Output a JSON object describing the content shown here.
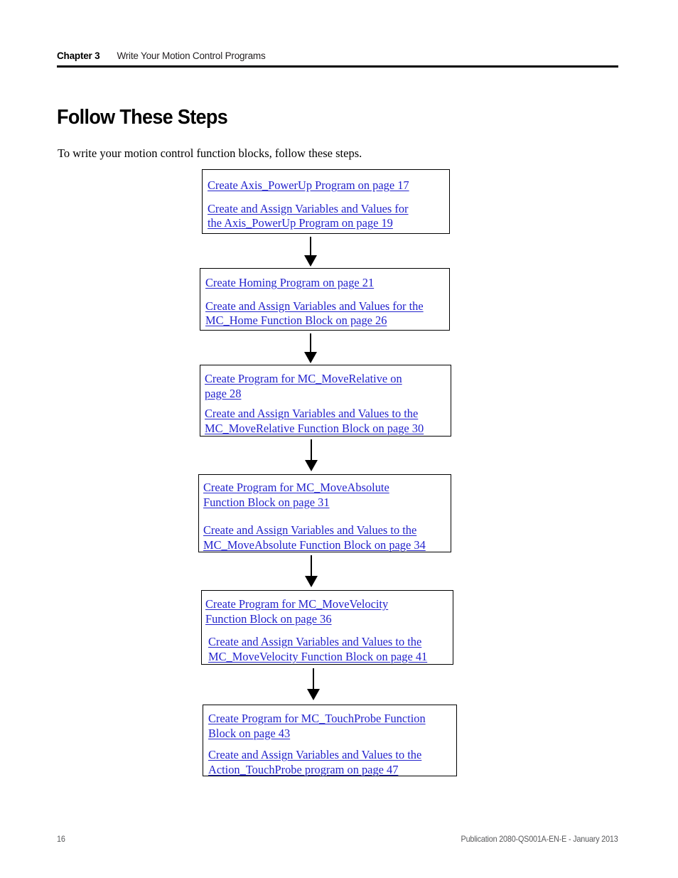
{
  "header": {
    "chapter_label": "Chapter 3",
    "chapter_title": "Write Your Motion Control Programs"
  },
  "section": {
    "title": "Follow These Steps",
    "intro": "To write your motion control function blocks, follow these steps."
  },
  "colors": {
    "link": "#2222CC",
    "rule": "#000000",
    "footer_text": "#58595B",
    "box_border": "#000000"
  },
  "flowchart": {
    "type": "vertical-sequence",
    "connector": "down-arrow",
    "steps": [
      {
        "id": "step-axis-powerup",
        "links": [
          "Create Axis_PowerUp Program on page 17",
          "Create and Assign Variables and Values for \nthe Axis_PowerUp Program on page 19"
        ]
      },
      {
        "id": "step-homing",
        "links": [
          "Create Homing Program on page 21",
          "Create and Assign Variables and Values for the \nMC_Home Function Block on page 26"
        ]
      },
      {
        "id": "step-move-relative",
        "links": [
          "Create Program for MC_MoveRelative on \npage 28",
          "Create and Assign Variables and Values to the \nMC_MoveRelative Function Block on page 30"
        ]
      },
      {
        "id": "step-move-absolute",
        "links": [
          "Create Program for MC_MoveAbsolute \nFunction Block on page 31",
          "Create and Assign Variables and Values to the \nMC_MoveAbsolute Function Block on page 34"
        ]
      },
      {
        "id": "step-move-velocity",
        "links": [
          "Create Program for MC_MoveVelocity \nFunction Block on page 36",
          "Create and Assign Variables and Values to the \nMC_MoveVelocity Function Block on page 41"
        ]
      },
      {
        "id": "step-touch-probe",
        "links": [
          "Create Program for MC_TouchProbe Function \nBlock on page 43",
          "Create and Assign Variables and Values to the \nAction_TouchProbe program on page 47"
        ]
      }
    ]
  },
  "footer": {
    "page_number": "16",
    "publication": "Publication 2080-QS001A-EN-E - January 2013"
  }
}
